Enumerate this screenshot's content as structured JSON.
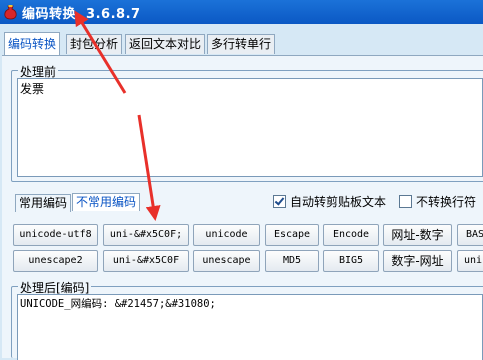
{
  "window": {
    "title": "编码转换  3.6.8.7"
  },
  "tabs": [
    "编码转换",
    "封包分析",
    "返回文本对比",
    "多行转单行"
  ],
  "input_group": {
    "label": "处理前",
    "value": "发票"
  },
  "subtabs": [
    "常用编码",
    "不常用编码"
  ],
  "options": [
    {
      "label": "自动转剪贴板文本",
      "checked": true
    },
    {
      "label": "不转换行符",
      "checked": false
    }
  ],
  "buttons_row1": [
    "unicode-utf8",
    "uni-&#x5C0F;",
    "unicode",
    "Escape",
    "Encode",
    "网址-数字",
    "BAS"
  ],
  "buttons_row2": [
    "unescape2",
    "uni-&#x5C0F",
    "unescape",
    "MD5",
    "BIG5",
    "数字-网址",
    "uni"
  ],
  "output_group": {
    "label": "处理后[编码]",
    "value": "UNICODE_网编码: &#21457;&#31080;"
  },
  "colors": {
    "titlebar": "#0b58c4",
    "arrow": "#e8302a",
    "active_tab_text": "#0a54c4"
  }
}
